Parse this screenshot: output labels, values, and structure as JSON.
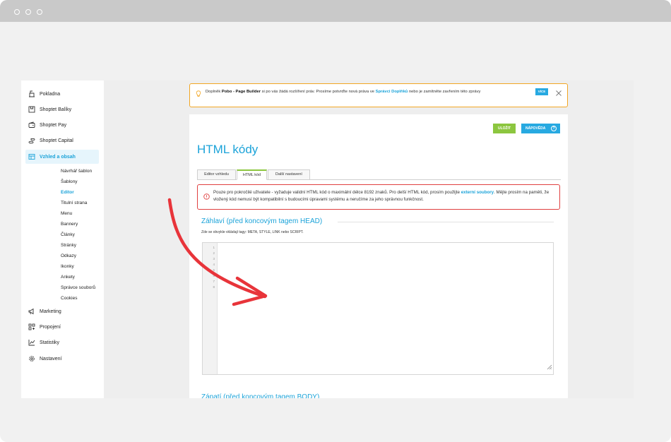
{
  "sidebar": {
    "items": [
      {
        "label": "Pokladna",
        "icon": "cash-register-icon"
      },
      {
        "label": "Shoptet Balíky",
        "icon": "package-icon"
      },
      {
        "label": "Shoptet Pay",
        "icon": "wallet-icon"
      },
      {
        "label": "Shoptet Capital",
        "icon": "coins-icon"
      },
      {
        "label": "Vzhled a obsah",
        "icon": "layout-icon"
      },
      {
        "label": "Marketing",
        "icon": "megaphone-icon"
      },
      {
        "label": "Propojení",
        "icon": "grid-icon"
      },
      {
        "label": "Statistiky",
        "icon": "chart-icon"
      },
      {
        "label": "Nastavení",
        "icon": "gear-icon"
      }
    ],
    "subitems": [
      "Návrhář šablon",
      "Šablony",
      "Editor",
      "Titulní strana",
      "Menu",
      "Bannery",
      "Články",
      "Stránky",
      "Odkazy",
      "Ikonky",
      "Ankety",
      "Správce souborů",
      "Cookies"
    ]
  },
  "notice": {
    "prefix": "Doplněk ",
    "addon": "Pobo - Page Builder",
    "middle": " si po vás žádá rozšíření práv. Prosíme potvrďte nová práva ve ",
    "link": "Správci Doplňků",
    "suffix": " nebo je zamítněte zavřením této zprávy",
    "button": "VÍCE"
  },
  "toolbar": {
    "save": "ULOŽIT",
    "help": "NÁPOVĚDA",
    "help_mark": "?"
  },
  "page": {
    "title": "HTML kódy"
  },
  "tabs": [
    "Editor vzhledu",
    "HTML kód",
    "Další nastavení"
  ],
  "warning": {
    "text1": "Pouze pro pokročilé uživatele - vyžaduje validní HTML kód o maximální délce 8192 znaků. Pro delší HTML kód, prosím použijte ",
    "link": "externí soubory",
    "text2": ". Mějte prosím na paměti, že vložený kód nemusí být kompatibilní s budoucími úpravami systému a neručíme za jeho správnou funkčnost."
  },
  "section_head": {
    "title": "Záhlaví (před koncovým tagem HEAD)",
    "hint": "Zde se obvykle vkládají tagy: META, STYLE, LINK nebo SCRIPT."
  },
  "editor": {
    "line_numbers": [
      "1",
      "2",
      "3",
      "4",
      "5",
      "6",
      "7",
      "8"
    ]
  },
  "section_body": {
    "title": "Zápatí (před koncovým tagem BODY)"
  },
  "colors": {
    "accent": "#1ba3d9",
    "save": "#8cc63f",
    "warning_border": "#e04040",
    "notice_border": "#f2a623",
    "arrow": "#e8343a"
  }
}
